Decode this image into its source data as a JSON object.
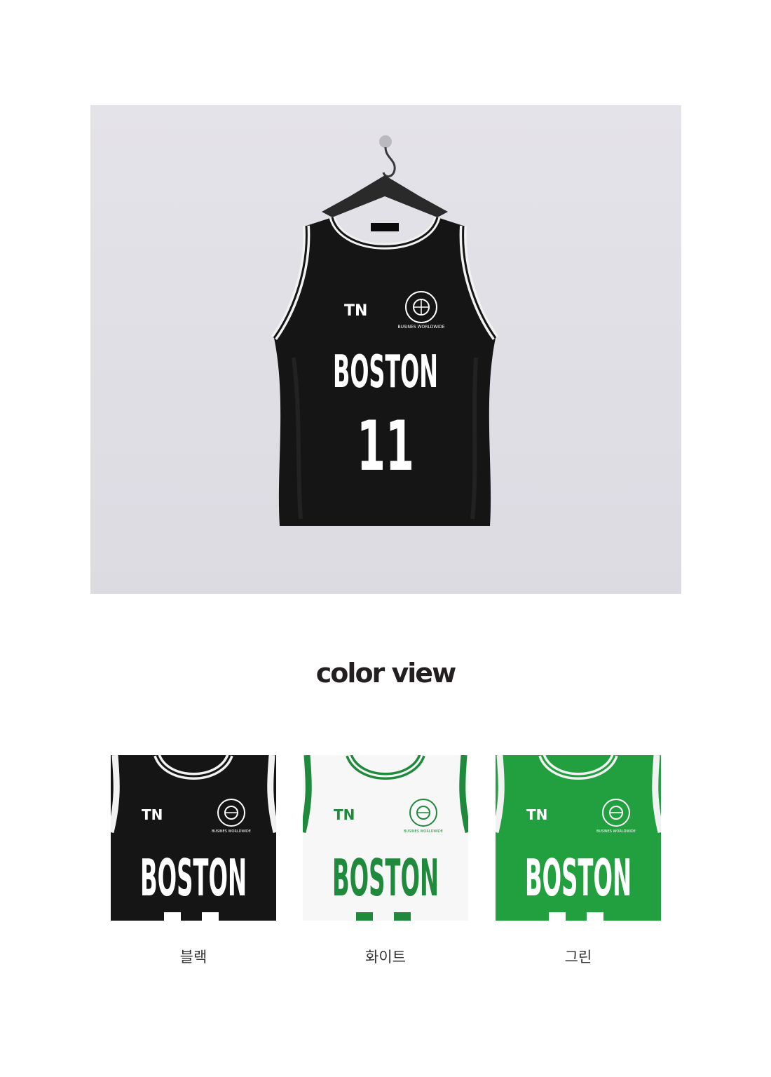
{
  "hero": {
    "jersey_text": "BOSTON",
    "jersey_number": "11",
    "logo_text": "TN",
    "badge_text": "BUSINES WORLDWIDE",
    "jersey_color": "#151515",
    "trim_color": "#f2f2f2"
  },
  "color_view": {
    "title": "color view",
    "options": [
      {
        "label": "블랙",
        "jersey_text": "BOSTON",
        "logo_text": "TN",
        "badge_text": "BUSINES WORLDWIDE",
        "body_color": "#151515",
        "text_color": "#ffffff"
      },
      {
        "label": "화이트",
        "jersey_text": "BOSTON",
        "logo_text": "TN",
        "badge_text": "BUSINES WORLDWIDE",
        "body_color": "#f7f7f7",
        "text_color": "#1f8a3c"
      },
      {
        "label": "그린",
        "jersey_text": "BOSTON",
        "logo_text": "TN",
        "badge_text": "BUSINES WORLDWIDE",
        "body_color": "#22a040",
        "text_color": "#ffffff"
      }
    ]
  }
}
